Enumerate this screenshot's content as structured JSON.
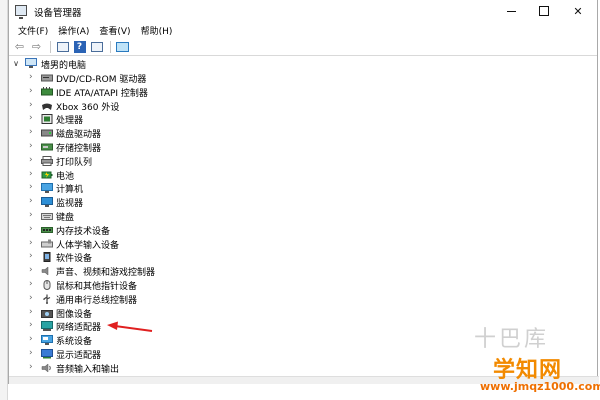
{
  "window": {
    "title": "设备管理器"
  },
  "menu": [
    "文件(F)",
    "操作(A)",
    "查看(V)",
    "帮助(H)"
  ],
  "toolbar": [
    {
      "icon": "back-arrow-icon"
    },
    {
      "icon": "forward-arrow-icon"
    },
    {
      "icon": "properties-icon"
    },
    {
      "icon": "help-icon",
      "text": "?"
    },
    {
      "icon": "window-icon"
    },
    {
      "icon": "scan-hardware-icon"
    }
  ],
  "tree": {
    "root": "墙男的电脑",
    "items": [
      {
        "label": "DVD/CD-ROM 驱动器",
        "icon": "dvd-drive-icon"
      },
      {
        "label": "IDE ATA/ATAPI 控制器",
        "icon": "ide-controller-icon"
      },
      {
        "label": "Xbox 360 外设",
        "icon": "xbox-controller-icon"
      },
      {
        "label": "处理器",
        "icon": "processor-icon"
      },
      {
        "label": "磁盘驱动器",
        "icon": "disk-drive-icon"
      },
      {
        "label": "存储控制器",
        "icon": "storage-controller-icon"
      },
      {
        "label": "打印队列",
        "icon": "printer-icon"
      },
      {
        "label": "电池",
        "icon": "battery-icon"
      },
      {
        "label": "计算机",
        "icon": "computer-icon"
      },
      {
        "label": "监视器",
        "icon": "monitor-icon"
      },
      {
        "label": "键盘",
        "icon": "keyboard-icon"
      },
      {
        "label": "内存技术设备",
        "icon": "memory-device-icon"
      },
      {
        "label": "人体学输入设备",
        "icon": "hid-icon"
      },
      {
        "label": "软件设备",
        "icon": "software-device-icon"
      },
      {
        "label": "声音、视频和游戏控制器",
        "icon": "sound-icon"
      },
      {
        "label": "鼠标和其他指针设备",
        "icon": "mouse-icon"
      },
      {
        "label": "通用串行总线控制器",
        "icon": "usb-icon"
      },
      {
        "label": "图像设备",
        "icon": "camera-icon"
      },
      {
        "label": "网络适配器",
        "icon": "network-adapter-icon"
      },
      {
        "label": "系统设备",
        "icon": "system-device-icon"
      },
      {
        "label": "显示适配器",
        "icon": "display-adapter-icon"
      },
      {
        "label": "音频输入和输出",
        "icon": "audio-io-icon"
      }
    ]
  },
  "watermark": {
    "chars": "十巴库",
    "logo": "学知网",
    "url": "www.jmqz1000.com"
  },
  "colors": {
    "annotation_arrow": "#e02020",
    "watermark_logo": "#f28a00"
  }
}
